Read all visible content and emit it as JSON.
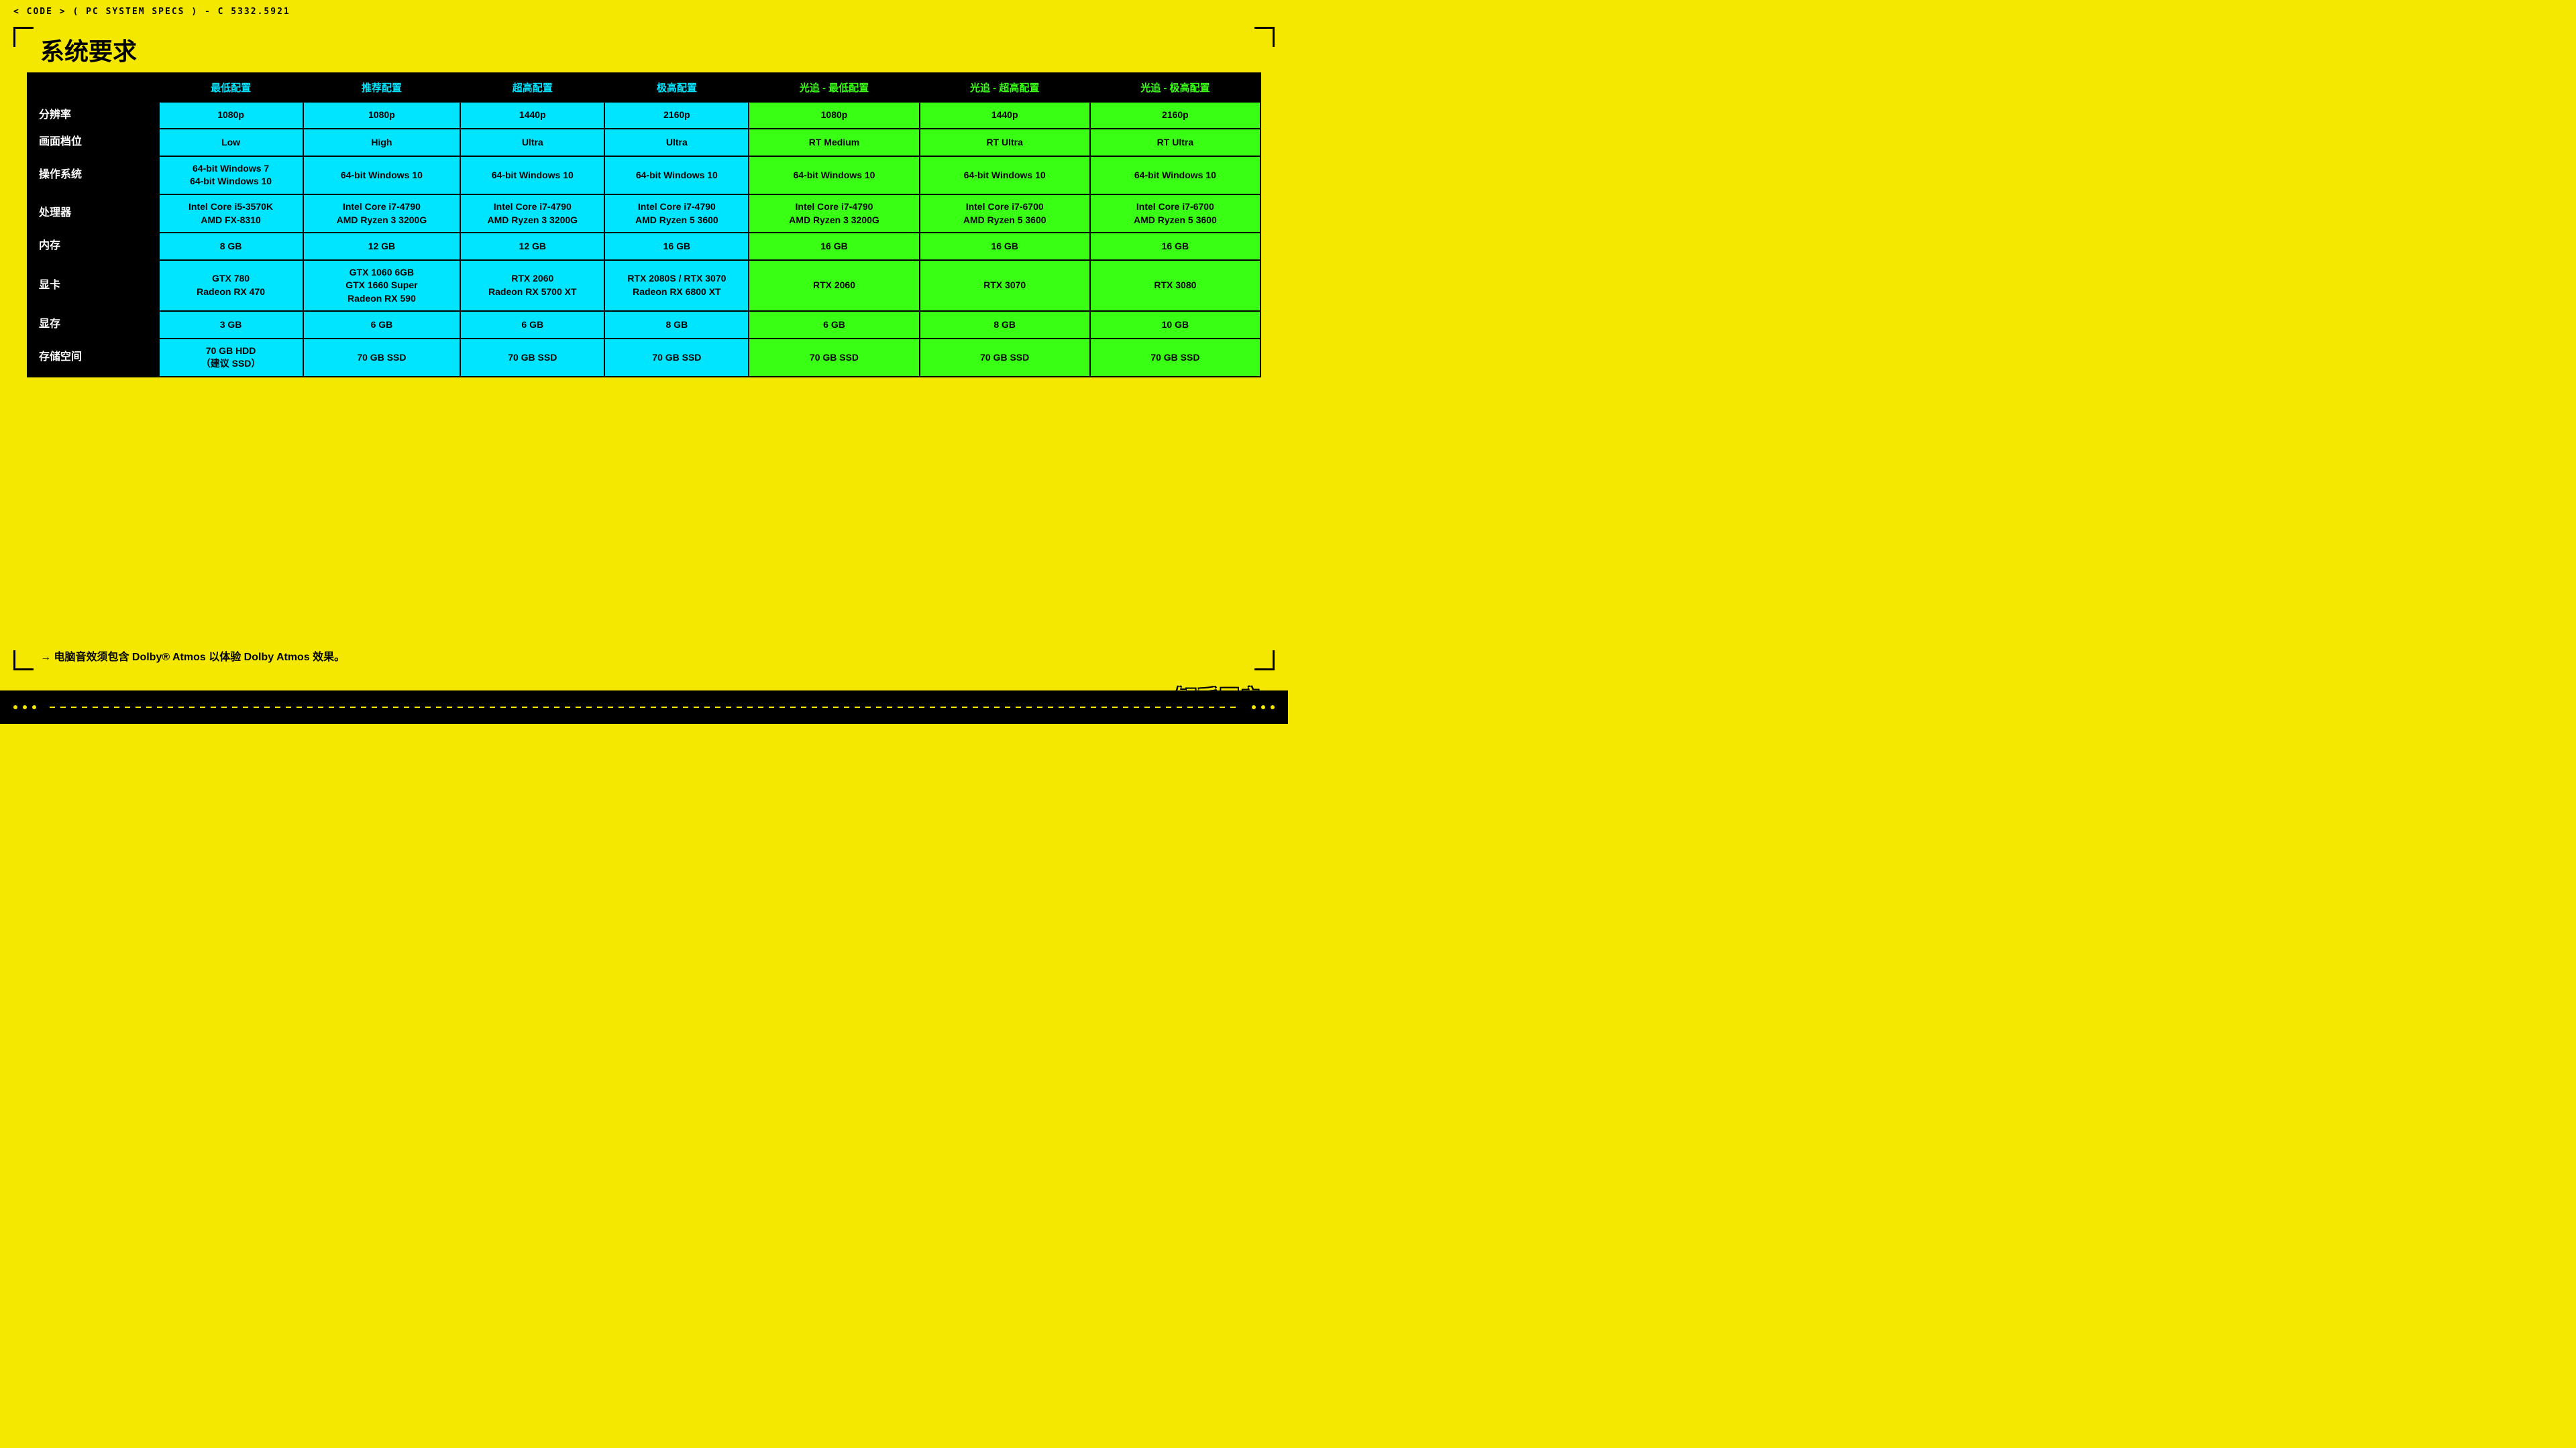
{
  "topbar": {
    "text": "< CODE > ( PC SYSTEM SPECS ) - C 5332.5921"
  },
  "page_title": "系统要求",
  "headers": {
    "row_label": "",
    "col1": "最低配置",
    "col2": "推荐配置",
    "col3": "超高配置",
    "col4": "极高配置",
    "col5": "光追 - 最低配置",
    "col6": "光追 - 超高配置",
    "col7": "光追 - 极高配置"
  },
  "rows": [
    {
      "label": "分辨率",
      "col1": "1080p",
      "col2": "1080p",
      "col3": "1440p",
      "col4": "2160p",
      "col5": "1080p",
      "col6": "1440p",
      "col7": "2160p"
    },
    {
      "label": "画面档位",
      "col1": "Low",
      "col2": "High",
      "col3": "Ultra",
      "col4": "Ultra",
      "col5": "RT Medium",
      "col6": "RT Ultra",
      "col7": "RT Ultra"
    },
    {
      "label": "操作系统",
      "col1": "64-bit Windows 7\n64-bit Windows 10",
      "col2": "64-bit Windows 10",
      "col3": "64-bit Windows 10",
      "col4": "64-bit Windows 10",
      "col5": "64-bit Windows 10",
      "col6": "64-bit Windows 10",
      "col7": "64-bit Windows 10"
    },
    {
      "label": "处理器",
      "col1": "Intel Core i5-3570K\nAMD FX-8310",
      "col2": "Intel Core i7-4790\nAMD Ryzen 3 3200G",
      "col3": "Intel Core i7-4790\nAMD Ryzen 3 3200G",
      "col4": "Intel Core i7-4790\nAMD Ryzen 5 3600",
      "col5": "Intel Core i7-4790\nAMD Ryzen 3 3200G",
      "col6": "Intel Core i7-6700\nAMD Ryzen 5 3600",
      "col7": "Intel Core i7-6700\nAMD Ryzen 5 3600"
    },
    {
      "label": "内存",
      "col1": "8 GB",
      "col2": "12 GB",
      "col3": "12 GB",
      "col4": "16 GB",
      "col5": "16 GB",
      "col6": "16 GB",
      "col7": "16 GB"
    },
    {
      "label": "显卡",
      "col1": "GTX 780\nRadeon RX 470",
      "col2": "GTX 1060 6GB\nGTX 1660 Super\nRadeon RX 590",
      "col3": "RTX 2060\nRadeon RX 5700 XT",
      "col4": "RTX 2080S / RTX 3070\nRadeon RX 6800 XT",
      "col5": "RTX 2060",
      "col6": "RTX 3070",
      "col7": "RTX 3080"
    },
    {
      "label": "显存",
      "col1": "3 GB",
      "col2": "6 GB",
      "col3": "6 GB",
      "col4": "8 GB",
      "col5": "6 GB",
      "col6": "8 GB",
      "col7": "10 GB"
    },
    {
      "label": "存储空间",
      "col1": "70 GB HDD\n（建议 SSD）",
      "col2": "70 GB SSD",
      "col3": "70 GB SSD",
      "col4": "70 GB SSD",
      "col5": "70 GB SSD",
      "col6": "70 GB SSD",
      "col7": "70 GB SSD"
    }
  ],
  "bottom_note": "→ 电脑音效须包含 Dolby® Atmos 以体验 Dolby Atmos 效果。",
  "watermark": "知乎用户"
}
